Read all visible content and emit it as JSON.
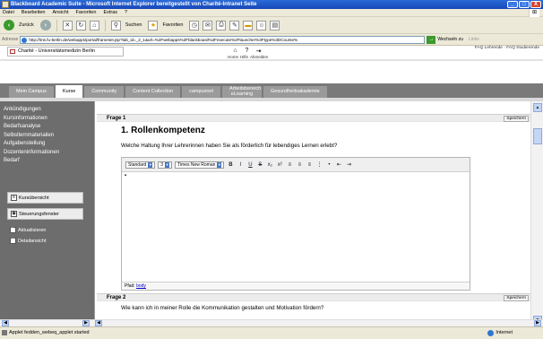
{
  "window": {
    "title": "Blackboard Academic Suite - Microsoft Internet Explorer bereitgestellt von Charité-Intranet Seite",
    "controls": [
      "_",
      "□",
      "X"
    ]
  },
  "menubar": {
    "items": [
      "Datei",
      "Bearbeiten",
      "Ansicht",
      "Favoriten",
      "Extras",
      "?"
    ]
  },
  "toolbar": {
    "back_label": "Zurück",
    "search_label": "Suchen",
    "favorites_label": "Favoriten"
  },
  "address": {
    "label": "Adresse",
    "url": "http://lms.fu-berlin.de/webapps/portal/frameset.jsp?tab_id=_2_1&url=%2Fwebapps%2Fblackboard%2Fexecute%2Flauncher%3Ftype%3DCourse%",
    "go_label": "Wechseln zu",
    "links_label": "Links"
  },
  "bb": {
    "frame_label": "Charité - Universitätsmedizin Berlin",
    "icons": [
      "home-icon",
      "help-icon",
      "logout-icon"
    ],
    "icon_labels": [
      "Home",
      "Hilfe",
      "Abmelden"
    ],
    "right_text": "FAQ Lehrende · FAQ Studierende"
  },
  "tabs": [
    {
      "label": "Mein Campus",
      "active": false
    },
    {
      "label": "Kurse",
      "active": true
    },
    {
      "label": "Community",
      "active": false
    },
    {
      "label": "Content Collection",
      "active": false
    },
    {
      "label": "campusnet",
      "active": false
    },
    {
      "label": "Arbeitsbereich eLearning",
      "active": false
    },
    {
      "label": "Gesundheitsakademie",
      "active": false
    }
  ],
  "sidebar": {
    "items": [
      "Ankündigungen",
      "Kursinformationen",
      "Bedarfsanalyse",
      "Selbstlernmaterialien",
      "Aufgabenstellung",
      "Dozenteninformationen",
      "Bedarf"
    ],
    "buttons": {
      "kurs": "Kursübersicht",
      "steuer": "Steuerungsfenster",
      "aktualisieren": "Aktualisieren",
      "detail": "Detailansicht"
    }
  },
  "frage1": {
    "label": "Frage 1",
    "save": "Speichern",
    "title": "1. Rollenkompetenz",
    "text": "Welche Haltung Ihrer Lehrerinnen haben Sie als förderlich für lebendiges Lernen erlebt?"
  },
  "editor": {
    "style": "Standard",
    "size": "3",
    "font": "Times New Roman",
    "path_label": "Pfad:",
    "path_value": "body"
  },
  "frage2": {
    "label": "Frage 2",
    "save": "Speichern",
    "text": "Wie kann ich in meiner Rolle die Kommunikation gestalten und Motivation fördern?"
  },
  "status": {
    "text": "Applet fedden_webeq_applet started",
    "zone": "Internet"
  }
}
